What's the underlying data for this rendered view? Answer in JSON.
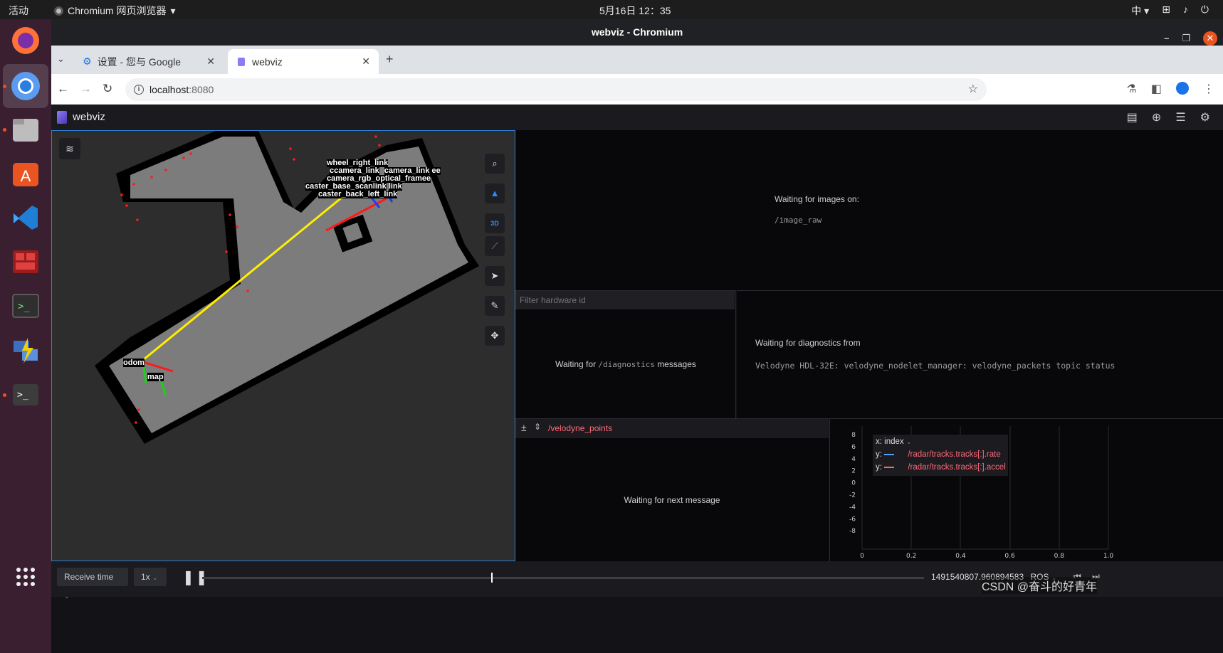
{
  "topbar": {
    "activities": "活动",
    "app_name": "Chromium 网页浏览器",
    "clock": "5月16日  12：35",
    "ime": "中"
  },
  "window": {
    "title": "webviz - Chromium"
  },
  "tabs": [
    {
      "label": "设置 - 您与 Google"
    },
    {
      "label": "webviz"
    }
  ],
  "address": {
    "host": "localhost",
    "port": ":8080"
  },
  "app": {
    "name": "webviz"
  },
  "scene_labels": {
    "odom": "odom",
    "map": "map",
    "camera_link": "camera_link",
    "camera_rgb_optical_frame": "camera_rgb_optical_framee",
    "wheel_right_link": "wheel_right_link",
    "caster_back_left": "caster_back_left_link",
    "base_scan": "caster_base_scanlink",
    "ccam": "ccamera_link",
    "ee": "ee",
    "link": "link"
  },
  "controls": {
    "three_d": "3D"
  },
  "image_panel": {
    "waiting": "Waiting for images on:",
    "topic": "/image_raw"
  },
  "diagnostics": {
    "filter_placeholder": "Filter hardware id",
    "waiting_prefix": "Waiting for",
    "topic": "/diagnostics",
    "waiting_suffix": "messages",
    "right_waiting": "Waiting for diagnostics from",
    "right_topic": "Velodyne HDL-32E: velodyne_nodelet_manager: velodyne_packets topic status"
  },
  "raw_messages": {
    "topic": "/velodyne_points",
    "waiting": "Waiting for next message"
  },
  "plot": {
    "x_label": "x:",
    "x_value": "index",
    "series": [
      {
        "prefix": "y:",
        "path": "/radar/tracks.tracks[:].rate",
        "color": "#4ea3ff"
      },
      {
        "prefix": "y:",
        "path": "/radar/tracks.tracks[:].accel",
        "color": "#ff6b5b"
      }
    ],
    "y_ticks": [
      "8",
      "6",
      "4",
      "2",
      "0",
      "-2",
      "-4",
      "-6",
      "-8"
    ],
    "x_ticks": [
      "0",
      "0.2",
      "0.4",
      "0.6",
      "0.8",
      "1.0"
    ]
  },
  "playback": {
    "time_mode": "Receive time",
    "speed": "1x",
    "timestamp": "1491540807.960894583",
    "time_format": "ROS"
  },
  "watermark": "CSDN @奋斗的好青年"
}
